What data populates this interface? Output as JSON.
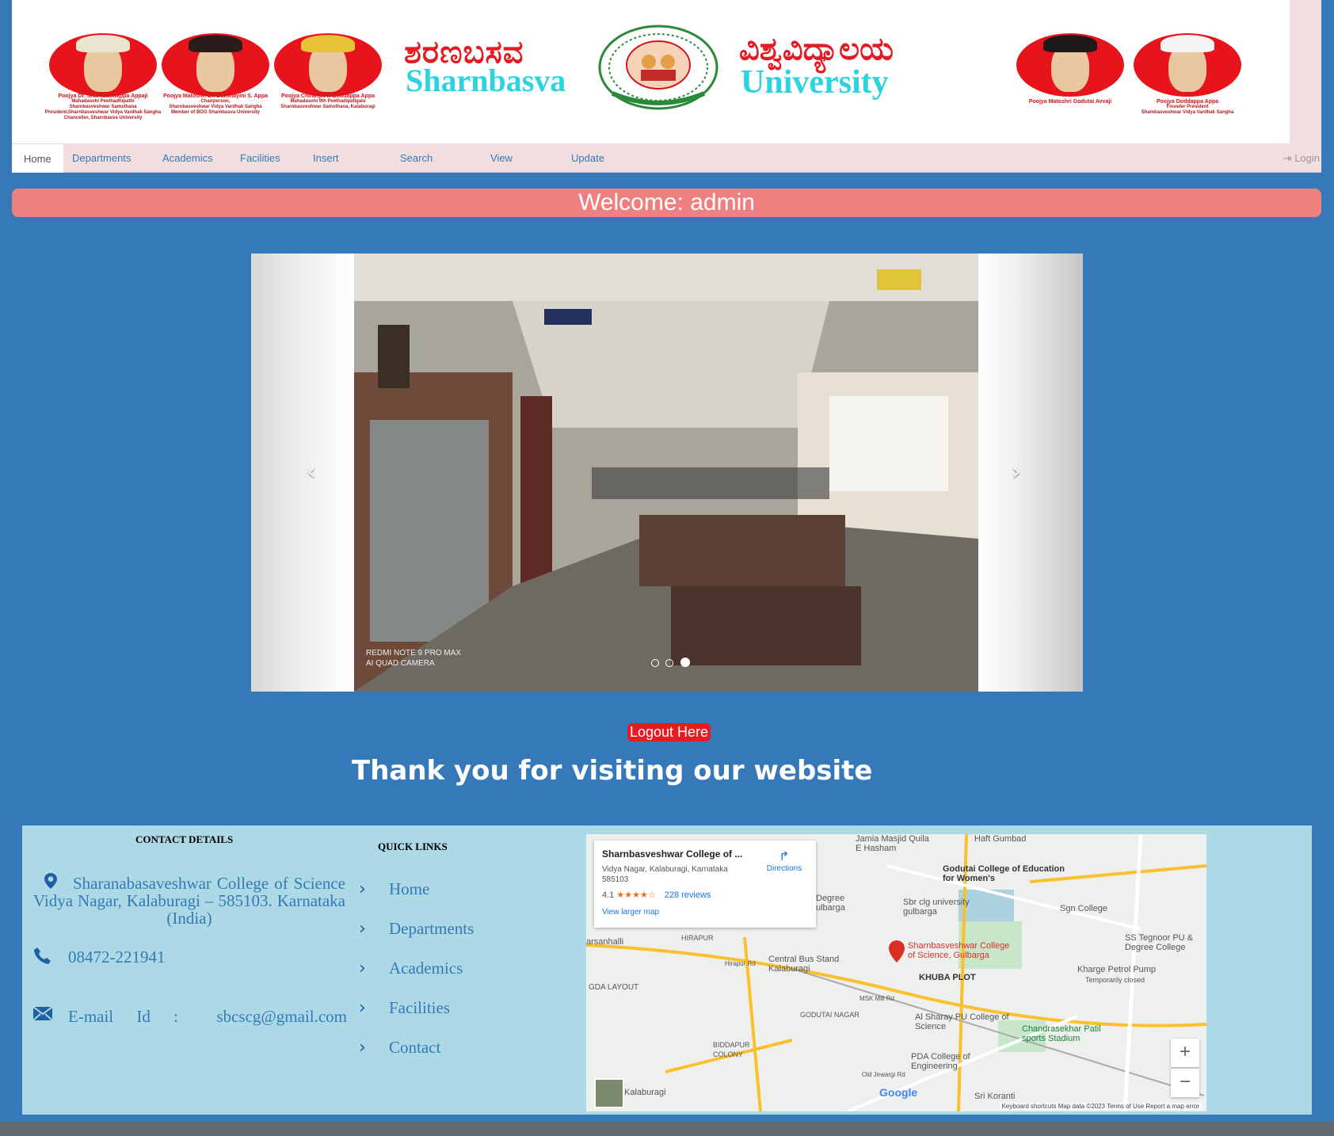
{
  "banner": {
    "title_kannada_left": "ಶರಣಬಸವ",
    "title_english_left": "Sharnbasva",
    "title_kannada_right": "ವಿಶ್ವವಿದ್ಯಾಲಯ",
    "title_english_right": "University",
    "captions": [
      {
        "name": "Poojya Dr. Sharnbaswappa Appaji",
        "lines": "Mahadasohi Peethadhipathi\nSharnbasveshwar Samsthana\nPresident,Sharnbasveshwar Vidya Vardhak Sangha\nChancellor, Sharnbasva University"
      },
      {
        "name": "Poojya Matoshri Dr. Dakshayini S. Appa",
        "lines": "Chairperson,\nSharnbasveshwar Vidya Vardhak Sangha\nMember of BOG Sharnbasva University"
      },
      {
        "name": "Poojya Chiranjeevi Doddappa Appa",
        "lines": "Mahadasohi 9th Peethadipatigalu\nSharnbasveshwar Samsthana, Kalaburagi"
      },
      {
        "name": "Poojya Matoshri Godutai Avvaji",
        "lines": ""
      },
      {
        "name": "Poojya Doddappa Appa",
        "lines": "Founder President\nShambasveshwar Vidya Vardhak Sangha"
      }
    ]
  },
  "nav": {
    "items": [
      "Home",
      "Departments",
      "Academics",
      "Facilities",
      "Insert Records",
      "Search Records",
      "View Records",
      "Update Records"
    ],
    "login": "Login"
  },
  "welcome": "Welcome: admin",
  "carousel": {
    "prev": "‹",
    "next": "›",
    "watermark_line1": "REDMI NOTE 9 PRO MAX",
    "watermark_line2": "AI QUAD CAMERA",
    "slides": 3,
    "active_slide": 3
  },
  "logout": "Logout Here",
  "thanks": "Thank you for visiting our website",
  "footer": {
    "contact_heading": "CONTACT DETAILS",
    "address": "Sharanabasaveshwar College of Science Vidya Nagar, Kalaburagi – 585103. Karnataka (India)",
    "phone": "08472-221941",
    "email_label": "E-mail Id :",
    "email": "sbcscg@gmail.com",
    "quick_heading": "QUICK LINKS",
    "quick_links": [
      "Home",
      "Departments",
      "Academics",
      "Facilities",
      "Contact"
    ]
  },
  "map": {
    "place_title": "Sharnbasveshwar College of ...",
    "place_address": "Vidya Nagar, Kalaburagi, Karnataka 585103",
    "rating": "4.1",
    "stars": "★★★★☆",
    "reviews": "228 reviews",
    "larger_map": "View larger map",
    "directions": "Directions",
    "pin_label": "Sharnbasveshwar College of Science, Gulbarga",
    "labels": [
      "Jamia Masjid Quila E Hasham",
      "Haft Gumbad",
      "Godutai College of Education for Women's",
      "Sbr clg university gulbarga",
      "Sgn College",
      "SS Tegnoor PU & Degree College",
      "Degree ulbarga",
      "arsanhalli",
      "HIRAPUR",
      "Central Bus Stand Kalaburagi",
      "KHUBA PLOT",
      "Kharge Petrol Pump",
      "Temporarily closed",
      "GDA LAYOUT",
      "GODUTAI NAGAR",
      "Al Sharay PU College of Science",
      "Chandrasekhar Patil sports Stadium",
      "BIDDAPUR COLONY",
      "PDA College of Engineering",
      "Kalaburagi",
      "Sri Koranti",
      "Hirapur Rd",
      "MSK Mill Rd",
      "Old Jewargi Rd"
    ],
    "footer": "Keyboard shortcuts   Map data ©2023   Terms of Use   Report a map error",
    "google": "Google"
  }
}
